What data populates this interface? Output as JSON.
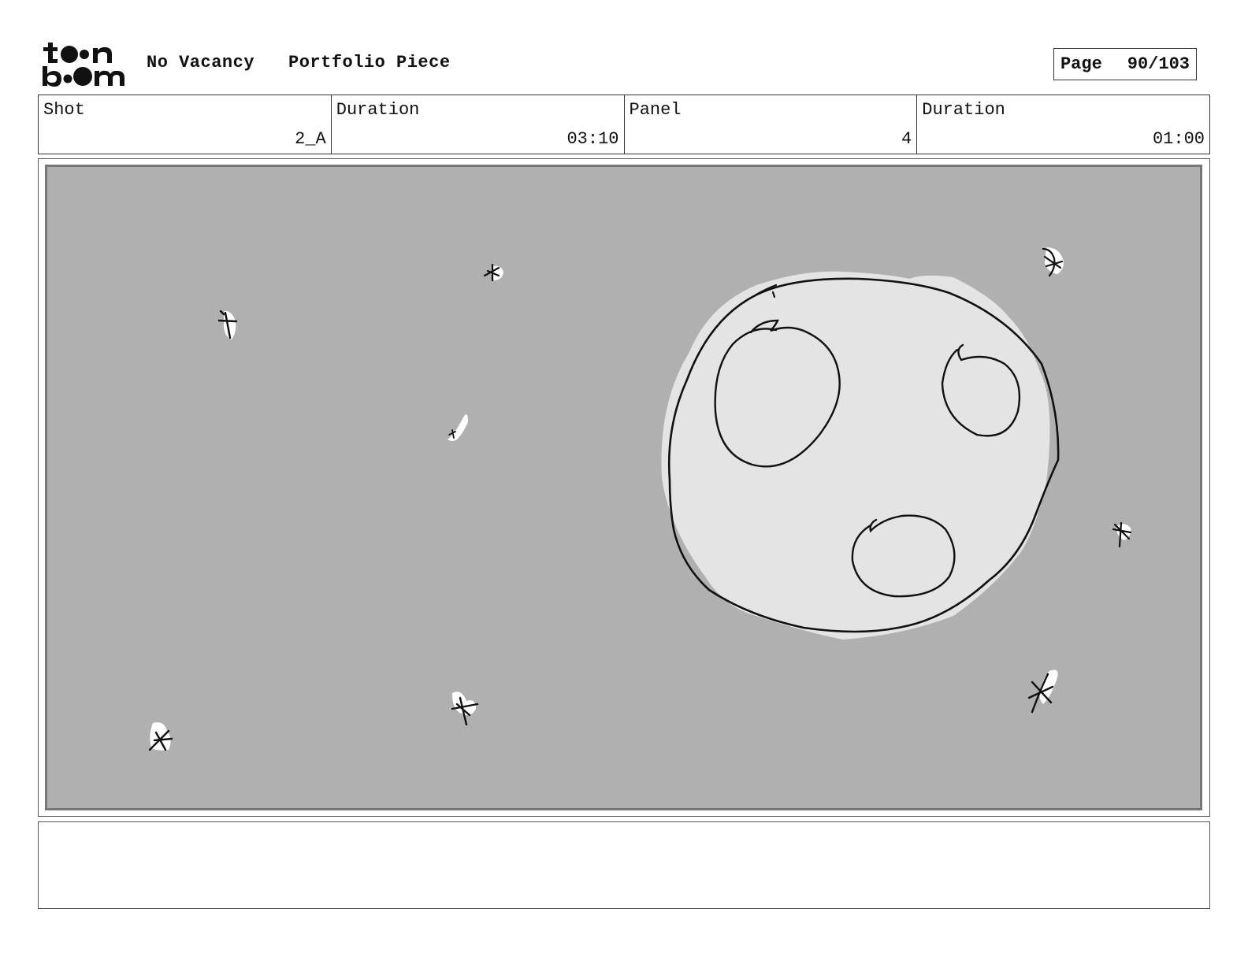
{
  "header": {
    "logo_text": "toon boom",
    "project_title": "No Vacancy",
    "subtitle": "Portfolio Piece",
    "page_label": "Page",
    "page_value": "90/103"
  },
  "info": {
    "shot_label": "Shot",
    "shot_value": "2_A",
    "shot_duration_label": "Duration",
    "shot_duration_value": "03:10",
    "panel_label": "Panel",
    "panel_value": "4",
    "panel_duration_label": "Duration",
    "panel_duration_value": "01:00"
  },
  "notes": {
    "text": ""
  },
  "colors": {
    "panel_background": "#b0b0b0",
    "moon_fill": "#e4e4e4",
    "sketch_line": "#111111",
    "border": "#333333"
  }
}
